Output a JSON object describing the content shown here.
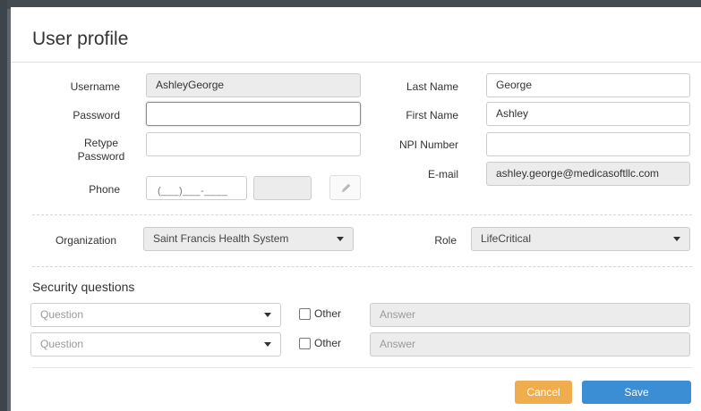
{
  "modal": {
    "title": "User profile"
  },
  "form": {
    "username_label": "Username",
    "username_value": "AshleyGeorge",
    "password_label": "Password",
    "password_value": "",
    "retype_label_1": "Retype",
    "retype_label_2": "Password",
    "retype_value": "",
    "phone_label": "Phone",
    "phone_mask": "(___)___-____",
    "phone_ext_value": "",
    "last_name_label": "Last Name",
    "last_name_value": "George",
    "first_name_label": "First Name",
    "first_name_value": "Ashley",
    "npi_label": "NPI Number",
    "npi_value": "",
    "email_label": "E-mail",
    "email_value": "ashley.george@medicasoftllc.com",
    "organization_label": "Organization",
    "organization_value": "Saint Francis Health System",
    "role_label": "Role",
    "role_value": "LifeCritical"
  },
  "security": {
    "title": "Security questions",
    "rows": [
      {
        "question_placeholder": "Question",
        "other_label": "Other",
        "answer_placeholder": "Answer"
      },
      {
        "question_placeholder": "Question",
        "other_label": "Other",
        "answer_placeholder": "Answer"
      }
    ]
  },
  "buttons": {
    "cancel": "Cancel",
    "save": "Save"
  },
  "colors": {
    "cancel": "#f0ad4e",
    "save": "#3b8ed4",
    "readonly_bg": "#ececec"
  },
  "icons": {
    "phone_edit": "pencil-icon",
    "dropdown": "chevron-down-icon",
    "checkbox": "checkbox-icon"
  }
}
